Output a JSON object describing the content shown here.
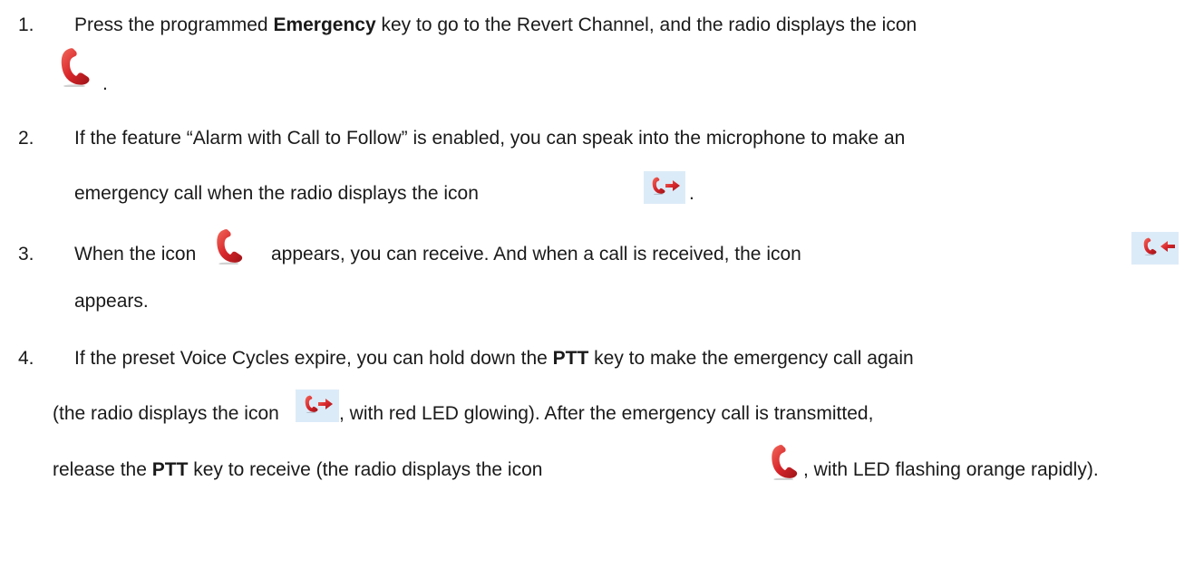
{
  "items": [
    {
      "number": "1.",
      "lines": [
        [
          "Press the programmed ",
          "Emergency",
          " key to go to the Revert Channel, and the radio displays the icon"
        ],
        [
          "."
        ]
      ],
      "icons": [
        "phone-icon"
      ]
    },
    {
      "number": "2.",
      "lines": [
        [
          "If the feature “Alarm with Call to Follow” is enabled, you can speak into the microphone to make an"
        ],
        [
          "emergency call when the radio displays the icon",
          "."
        ]
      ],
      "icons": [
        "phone-transmit-icon"
      ]
    },
    {
      "number": "3.",
      "lines": [
        [
          "When the icon",
          "appears, you can receive. And when a call is received, the icon"
        ],
        [
          "appears."
        ]
      ],
      "icons": [
        "phone-icon",
        "phone-receive-icon"
      ]
    },
    {
      "number": "4.",
      "lines": [
        [
          "If the preset Voice Cycles expire, you can hold down the ",
          "PTT",
          " key to make the emergency call again"
        ],
        [
          "(the radio displays the icon",
          ", with red LED glowing). After the emergency call is transmitted,"
        ],
        [
          "release the ",
          "PTT",
          " key to receive (the radio displays the icon",
          ", with LED flashing orange rapidly)."
        ]
      ],
      "icons": [
        "phone-transmit-icon",
        "phone-icon"
      ]
    }
  ],
  "colors": {
    "icon_red": "#d8262b",
    "icon_bg": "#dcebf8",
    "text": "#1a1a1a"
  }
}
